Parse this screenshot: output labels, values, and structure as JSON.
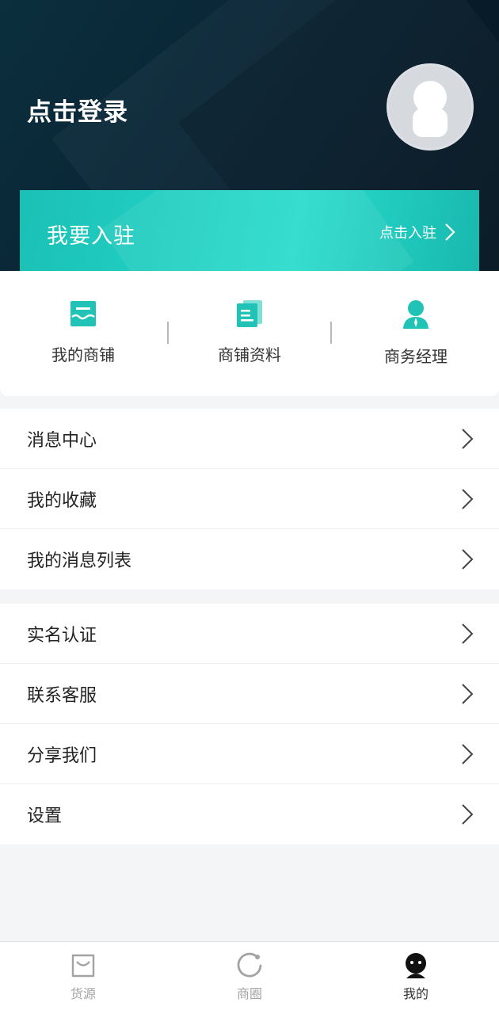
{
  "header": {
    "login_text": "点击登录"
  },
  "join": {
    "title": "我要入驻",
    "link_label": "点击入驻"
  },
  "quick_actions": [
    {
      "label": "我的商铺",
      "icon": "store-icon"
    },
    {
      "label": "商铺资料",
      "icon": "document-icon"
    },
    {
      "label": "商务经理",
      "icon": "manager-icon"
    }
  ],
  "menu_group_1": [
    {
      "label": "消息中心"
    },
    {
      "label": "我的收藏"
    },
    {
      "label": "我的消息列表"
    }
  ],
  "menu_group_2": [
    {
      "label": "实名认证"
    },
    {
      "label": "联系客服"
    },
    {
      "label": "分享我们"
    },
    {
      "label": "设置"
    }
  ],
  "tabbar": {
    "items": [
      {
        "label": "货源",
        "icon": "bag-icon",
        "active": false
      },
      {
        "label": "商圈",
        "icon": "circle-icon",
        "active": false
      },
      {
        "label": "我的",
        "icon": "profile-icon",
        "active": true
      }
    ]
  },
  "colors": {
    "accent": "#1fc9bc",
    "header_dark": "#0a2535",
    "background": "#f4f5f7"
  }
}
